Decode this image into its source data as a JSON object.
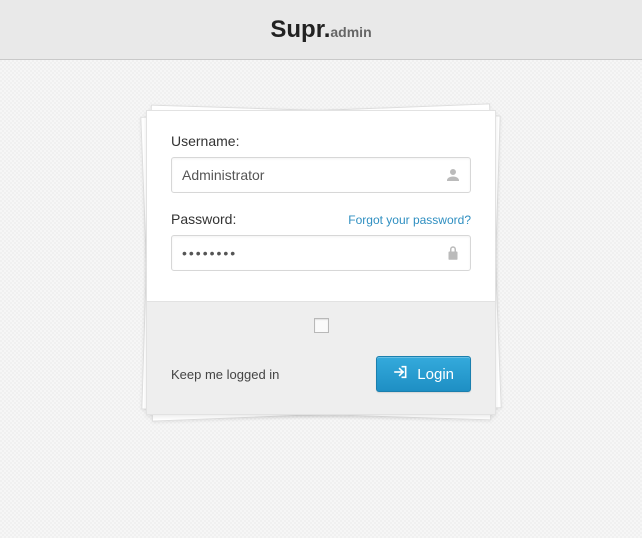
{
  "brand": {
    "main": "Supr.",
    "sub": "admin"
  },
  "form": {
    "username": {
      "label": "Username:",
      "value": "Administrator"
    },
    "password": {
      "label": "Password:",
      "value": "••••••••"
    },
    "forgot_label": "Forgot your password?",
    "remember_label": "Keep me logged in",
    "remember_checked": false,
    "submit_label": "Login"
  },
  "colors": {
    "accent": "#1e8fc4"
  }
}
